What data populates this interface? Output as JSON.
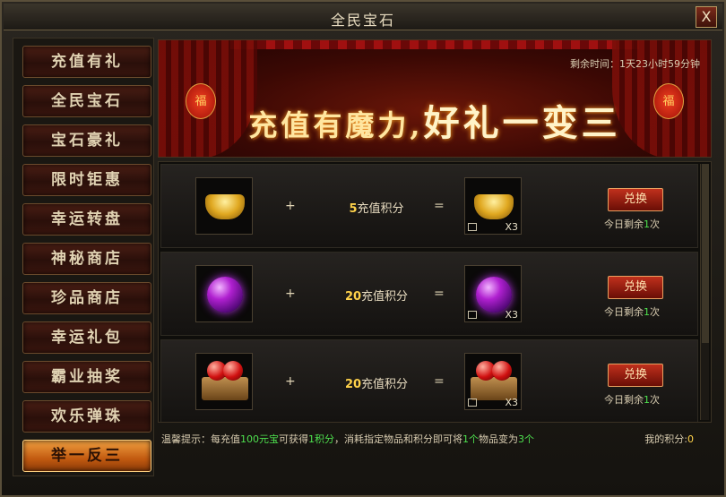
{
  "window": {
    "title": "全民宝石",
    "close_label": "X"
  },
  "sidebar": {
    "items": [
      {
        "label": "充值有礼",
        "active": false
      },
      {
        "label": "全民宝石",
        "active": false
      },
      {
        "label": "宝石豪礼",
        "active": false
      },
      {
        "label": "限时钜惠",
        "active": false
      },
      {
        "label": "幸运转盘",
        "active": false
      },
      {
        "label": "神秘商店",
        "active": false
      },
      {
        "label": "珍品商店",
        "active": false
      },
      {
        "label": "幸运礼包",
        "active": false
      },
      {
        "label": "霸业抽奖",
        "active": false
      },
      {
        "label": "欢乐弹珠",
        "active": false
      },
      {
        "label": "举一反三",
        "active": true
      }
    ]
  },
  "banner": {
    "countdown": "剩余时间：1天23小时59分钟",
    "slogan_part1": "充值有魔力,",
    "slogan_part2": "好礼一变三",
    "lantern_char": "福"
  },
  "offers": [
    {
      "item": "gold-ingot",
      "plus": "+",
      "cost_num": "5",
      "cost_text": "充值积分",
      "eq": "=",
      "qty": "X3",
      "button": "兑换",
      "remain_prefix": "今日剩余",
      "remain_num": "1",
      "remain_suffix": "次"
    },
    {
      "item": "purple-orb",
      "plus": "+",
      "cost_num": "20",
      "cost_text": "充值积分",
      "eq": "=",
      "qty": "X3",
      "button": "兑换",
      "remain_prefix": "今日剩余",
      "remain_num": "1",
      "remain_suffix": "次"
    },
    {
      "item": "ruby-box",
      "plus": "+",
      "cost_num": "20",
      "cost_text": "充值积分",
      "eq": "=",
      "qty": "X3",
      "button": "兑换",
      "remain_prefix": "今日剩余",
      "remain_num": "1",
      "remain_suffix": "次"
    }
  ],
  "footer": {
    "tip_a": "温馨提示：每充值",
    "tip_b": "100元宝",
    "tip_c": "可获得",
    "tip_d": "1积分",
    "tip_e": "，消耗指定物品和积分即可将",
    "tip_f": "1个",
    "tip_g": "物品变为",
    "tip_h": "3个",
    "score_label": "我的积分:",
    "score_value": "0"
  }
}
